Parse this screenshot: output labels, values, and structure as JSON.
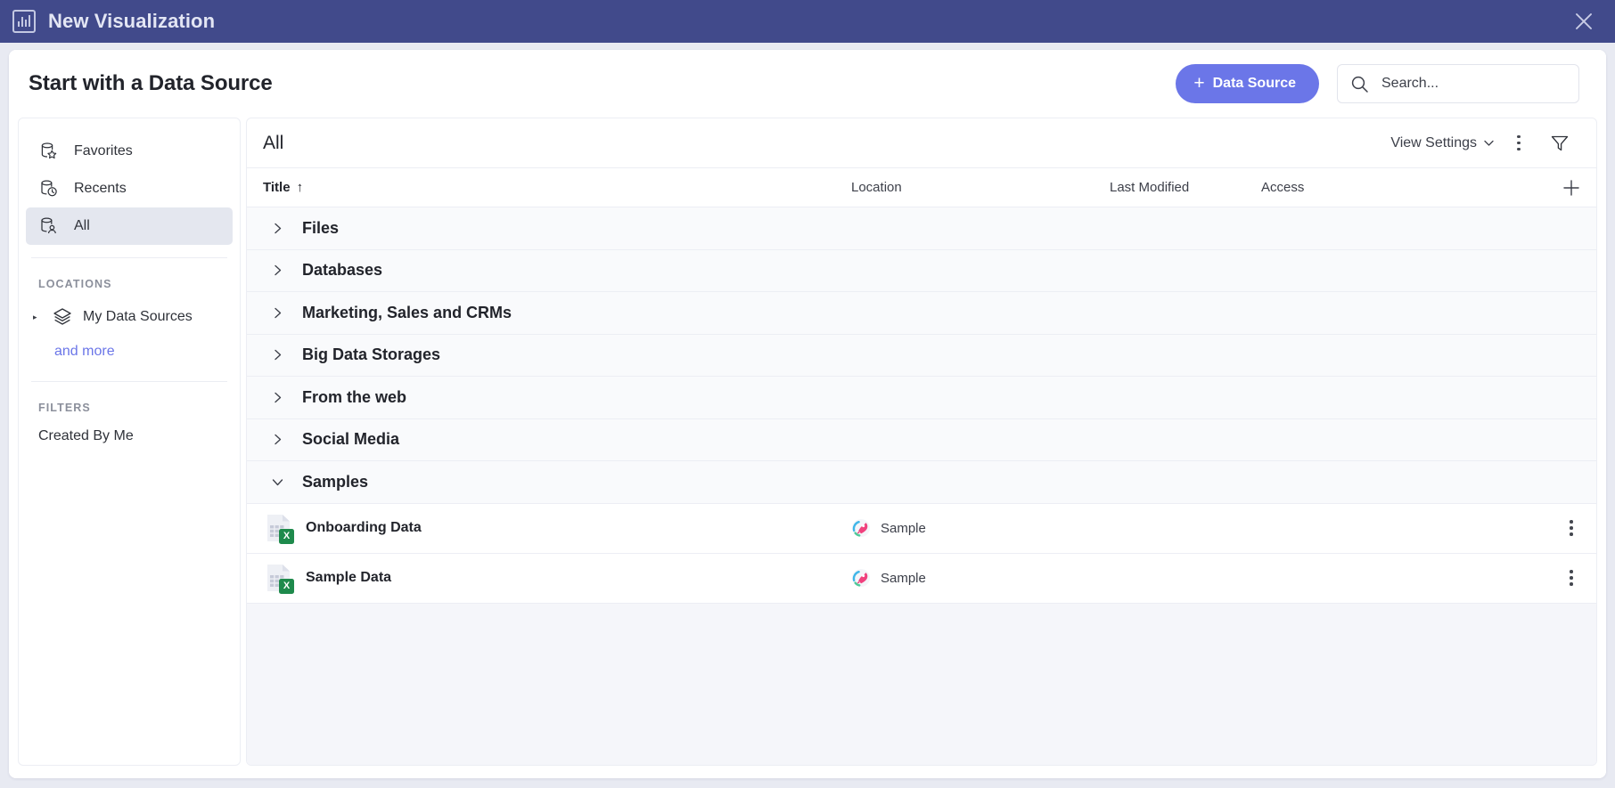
{
  "window": {
    "title": "New Visualization",
    "app_icon": "bar-chart-icon",
    "close_icon": "close-icon",
    "titlebar_color": "#414a8b"
  },
  "header": {
    "title": "Start with a Data Source",
    "data_source_button": "Data Source",
    "data_source_button_color": "#6b76e8",
    "plus_glyph": "+",
    "search": {
      "placeholder": "Search...",
      "value": "",
      "icon": "search-icon"
    }
  },
  "sidebar": {
    "nav": [
      {
        "label": "Favorites",
        "icon": "database-star-icon",
        "active": false
      },
      {
        "label": "Recents",
        "icon": "database-clock-icon",
        "active": false
      },
      {
        "label": "All",
        "icon": "database-user-icon",
        "active": true
      }
    ],
    "locations_label": "LOCATIONS",
    "locations": [
      {
        "label": "My Data Sources",
        "icon": "layers-icon",
        "expanded": false
      }
    ],
    "and_more": "and more",
    "and_more_color": "#6b76e8",
    "filters_label": "FILTERS",
    "filters": [
      {
        "label": "Created By Me"
      }
    ]
  },
  "main": {
    "view_label": "All",
    "view_settings": "View Settings",
    "view_settings_caret": "chevron-down-icon",
    "more_icon": "kebab-menu-icon",
    "filter_icon": "funnel-icon",
    "columns": {
      "title": "Title",
      "sort_indicator": "↑",
      "location": "Location",
      "last_modified": "Last Modified",
      "access": "Access",
      "add": "plus-icon"
    },
    "groups": [
      {
        "name": "Files",
        "expanded": false
      },
      {
        "name": "Databases",
        "expanded": false
      },
      {
        "name": "Marketing, Sales and CRMs",
        "expanded": false
      },
      {
        "name": "Big Data Storages",
        "expanded": false
      },
      {
        "name": "From the web",
        "expanded": false
      },
      {
        "name": "Social Media",
        "expanded": false
      },
      {
        "name": "Samples",
        "expanded": true
      }
    ],
    "files": [
      {
        "title": "Onboarding Data",
        "file_icon": "excel-file-icon",
        "file_badge": "X",
        "location": "Sample",
        "location_icon": "rocket-icon",
        "last_modified": "",
        "access": "",
        "menu_icon": "kebab-menu-icon"
      },
      {
        "title": "Sample Data",
        "file_icon": "excel-file-icon",
        "file_badge": "X",
        "location": "Sample",
        "location_icon": "rocket-icon",
        "last_modified": "",
        "access": "",
        "menu_icon": "kebab-menu-icon"
      }
    ]
  }
}
